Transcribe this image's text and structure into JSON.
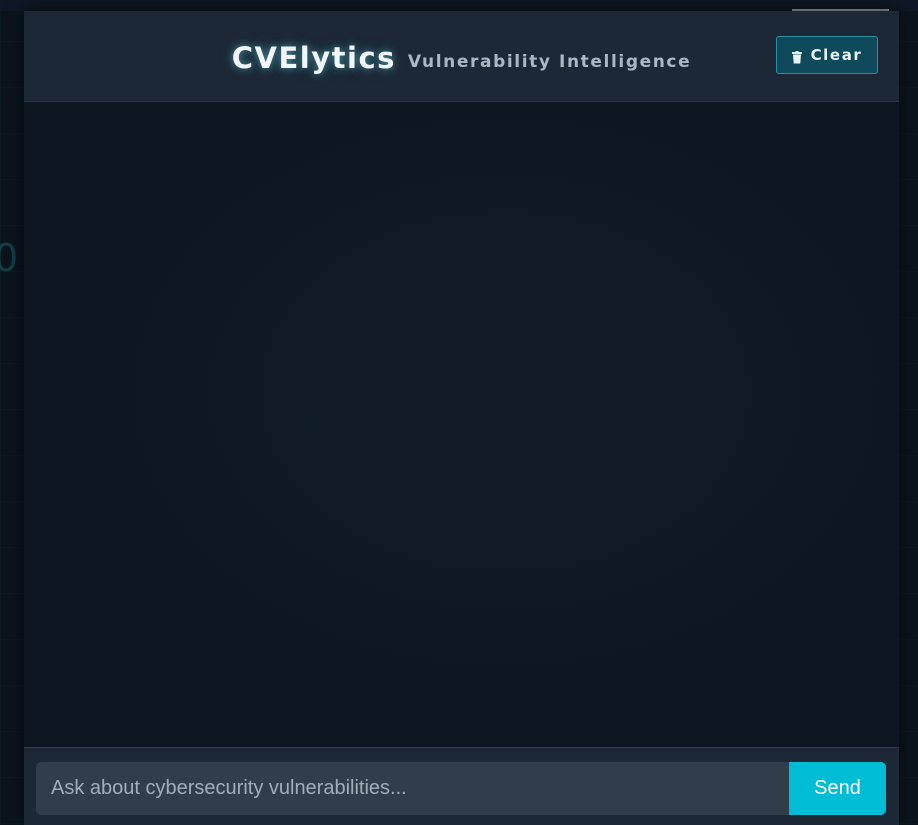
{
  "header": {
    "title": "CVElytics",
    "subtitle": "Vulnerability Intelligence",
    "clear_label": "Clear",
    "clear_icon": "trash-icon"
  },
  "background": {
    "side_glyph": "0"
  },
  "input": {
    "placeholder": "Ask about cybersecurity vulnerabilities...",
    "value": "",
    "send_label": "Send"
  },
  "colors": {
    "accent": "#00bcd4",
    "clear_button_bg": "#0e4a5c",
    "panel_bg": "#0e1621",
    "header_bg": "#1d2836"
  }
}
